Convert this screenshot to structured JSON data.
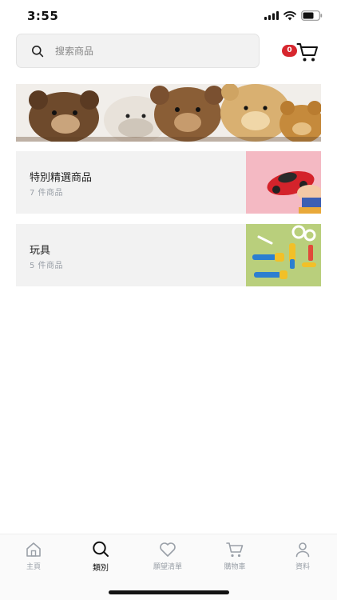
{
  "status_bar": {
    "time": "3:55"
  },
  "search": {
    "placeholder": "搜索商品"
  },
  "cart": {
    "count": "0"
  },
  "categories": [
    {
      "title": "特別精選商品",
      "count": "7 件商品"
    },
    {
      "title": "玩具",
      "count": "5 件商品"
    }
  ],
  "tabs": [
    {
      "label": "主頁",
      "icon": "home-icon"
    },
    {
      "label": "類別",
      "icon": "search-icon"
    },
    {
      "label": "願望清單",
      "icon": "heart-icon"
    },
    {
      "label": "購物車",
      "icon": "cart-icon"
    },
    {
      "label": "資料",
      "icon": "profile-icon"
    }
  ],
  "active_tab": "類別",
  "colors": {
    "badge": "#d7262e",
    "tile": "#f2f2f2",
    "muted": "#9aa0a8"
  }
}
